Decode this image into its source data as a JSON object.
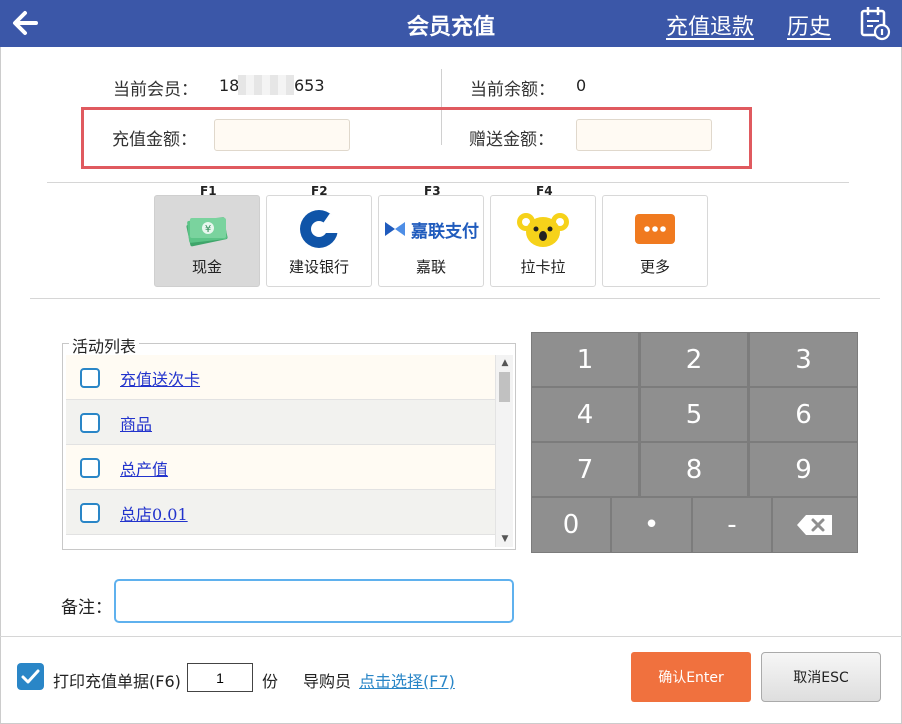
{
  "header": {
    "title": "会员充值",
    "refund_link": "充值退款",
    "history_link": "历史"
  },
  "member": {
    "member_label": "当前会员：",
    "member_prefix": "18",
    "member_suffix": "653",
    "balance_label": "当前余额：",
    "balance_value": "0",
    "recharge_label": "充值金额：",
    "recharge_value": "",
    "gift_label": "赠送金额：",
    "gift_value": ""
  },
  "payment_methods": [
    {
      "key": "F1",
      "label": "现金",
      "icon": "cash-icon",
      "selected": true
    },
    {
      "key": "F2",
      "label": "建设银行",
      "icon": "ccb-bank-icon"
    },
    {
      "key": "F3",
      "label": "嘉联",
      "icon": "jialian-pay-icon",
      "logo_text": "嘉联支付"
    },
    {
      "key": "F4",
      "label": "拉卡拉",
      "icon": "lakala-koala-icon"
    },
    {
      "label": "更多",
      "icon": "more-dots-icon"
    }
  ],
  "activities": {
    "title": "活动列表",
    "items": [
      {
        "name": "充值送次卡",
        "checked": false
      },
      {
        "name": "商品",
        "checked": false
      },
      {
        "name": "总产值",
        "checked": false
      },
      {
        "name": "总店0.01",
        "checked": false
      }
    ]
  },
  "keypad": {
    "keys": [
      "1",
      "2",
      "3",
      "4",
      "5",
      "6",
      "7",
      "8",
      "9",
      "0",
      "•",
      "-"
    ],
    "backspace_icon": "backspace-icon"
  },
  "remark": {
    "label": "备注：",
    "value": ""
  },
  "footer": {
    "print_label": "打印充值单据(F6)",
    "print_checked": true,
    "copies_value": "1",
    "copies_unit": "份",
    "guide_label": "导购员",
    "guide_link": "点击选择(F7)",
    "confirm_label": "确认Enter",
    "cancel_label": "取消ESC"
  },
  "colors": {
    "titlebar": "#3b57a8",
    "highlight_frame": "#e05a5f",
    "confirm": "#f0713e",
    "keypad": "#8f8f8f",
    "link": "#2233cc",
    "checkbox": "#2a86c7"
  }
}
